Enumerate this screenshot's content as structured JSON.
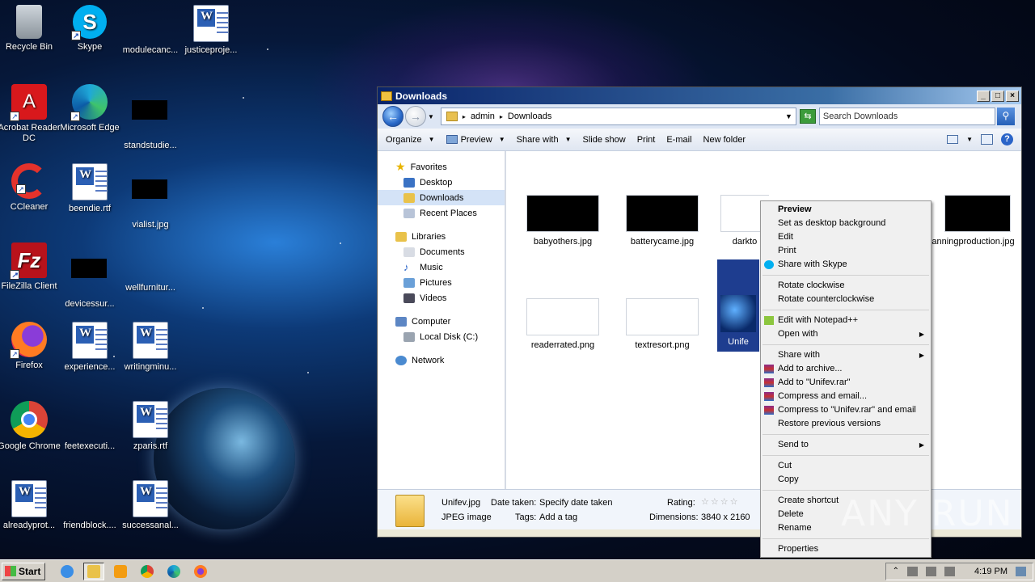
{
  "desktop": {
    "icons": [
      {
        "label": "Recycle Bin"
      },
      {
        "label": "Skype"
      },
      {
        "label": "modulecanc..."
      },
      {
        "label": "justiceproje..."
      },
      {
        "label": "Acrobat Reader DC"
      },
      {
        "label": "Microsoft Edge"
      },
      {
        "label": "standstudie..."
      },
      {
        "label": "CCleaner"
      },
      {
        "label": "beendie.rtf"
      },
      {
        "label": "vialist.jpg"
      },
      {
        "label": "FileZilla Client"
      },
      {
        "label": "devicessur..."
      },
      {
        "label": "wellfurnitur..."
      },
      {
        "label": "Firefox"
      },
      {
        "label": "experience..."
      },
      {
        "label": "writingminu..."
      },
      {
        "label": "Google Chrome"
      },
      {
        "label": "feetexecuti..."
      },
      {
        "label": "zparis.rtf"
      },
      {
        "label": "alreadyprot..."
      },
      {
        "label": "friendblock...."
      },
      {
        "label": "successanal..."
      }
    ]
  },
  "window": {
    "title": "Downloads",
    "address": {
      "segment1": "admin",
      "segment2": "Downloads"
    },
    "search_placeholder": "Search Downloads",
    "toolbar": {
      "organize": "Organize",
      "preview": "Preview",
      "share_with": "Share with",
      "slide_show": "Slide show",
      "print": "Print",
      "email": "E-mail",
      "new_folder": "New folder"
    },
    "nav": {
      "favorites": "Favorites",
      "desktop": "Desktop",
      "downloads": "Downloads",
      "recent": "Recent Places",
      "libraries": "Libraries",
      "documents": "Documents",
      "music": "Music",
      "pictures": "Pictures",
      "videos": "Videos",
      "computer": "Computer",
      "local_disk": "Local Disk (C:)",
      "network": "Network"
    },
    "files": [
      {
        "name": "babyothers.jpg"
      },
      {
        "name": "batterycame.jpg"
      },
      {
        "name": "darkto"
      },
      {
        "name": "anningproduction.jpg"
      },
      {
        "name": "readerrated.png"
      },
      {
        "name": "textresort.png"
      },
      {
        "name": "Unife"
      }
    ],
    "details": {
      "filename": "Unifev.jpg",
      "date_taken_label": "Date taken:",
      "date_taken_value": "Specify date taken",
      "type": "JPEG image",
      "tags_label": "Tags:",
      "tags_value": "Add a tag",
      "rating_label": "Rating:",
      "dimensions_label": "Dimensions:",
      "dimensions_value": "3840 x 2160"
    }
  },
  "context_menu": {
    "preview": "Preview",
    "set_bg": "Set as desktop background",
    "edit": "Edit",
    "print": "Print",
    "share_skype": "Share with Skype",
    "rotate_cw": "Rotate clockwise",
    "rotate_ccw": "Rotate counterclockwise",
    "edit_npp": "Edit with Notepad++",
    "open_with": "Open with",
    "share_with": "Share with",
    "add_archive": "Add to archive...",
    "add_rar": "Add to \"Unifev.rar\"",
    "compress_email": "Compress and email...",
    "compress_rar_email": "Compress to \"Unifev.rar\" and email",
    "restore": "Restore previous versions",
    "send_to": "Send to",
    "cut": "Cut",
    "copy": "Copy",
    "create_shortcut": "Create shortcut",
    "delete": "Delete",
    "rename": "Rename",
    "properties": "Properties"
  },
  "watermark": "ANY RUN",
  "taskbar": {
    "start": "Start",
    "time": "4:19 PM"
  }
}
